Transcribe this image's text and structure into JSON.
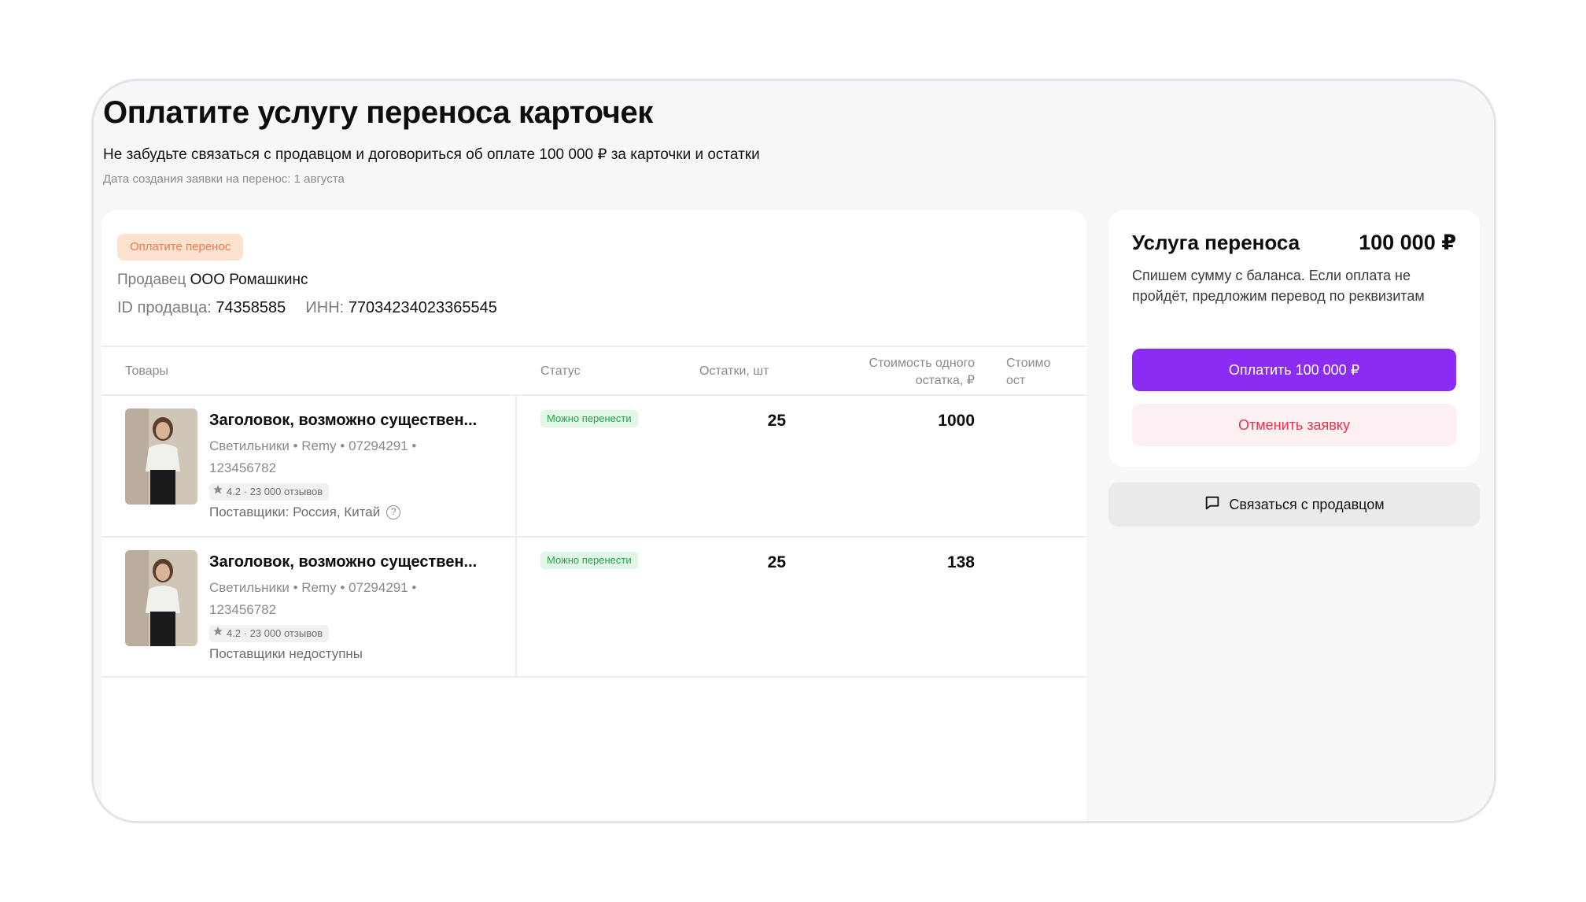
{
  "header": {
    "title": "Оплатите услугу переноса карточек",
    "subtitle": "Не забудьте связаться с продавцом и договориться об оплате 100 000 ₽ за карточки и остатки",
    "date": "Дата создания заявки на перенос: 1 августа"
  },
  "seller": {
    "status_badge": "Оплатите перенос",
    "seller_label": "Продавец",
    "seller_name": "ООО Ромашкинс",
    "id_label": "ID продавца:",
    "id_value": "74358585",
    "inn_label": "ИНН:",
    "inn_value": "77034234023365545"
  },
  "table": {
    "columns": {
      "goods": "Товары",
      "status": "Статус",
      "stock": "Остатки, шт",
      "price_line1": "Стоимость одного",
      "price_line2": "остатка, ₽",
      "total_line1": "Стоимо",
      "total_line2": "ост"
    },
    "rows": [
      {
        "title": "Заголовок, возможно существен...",
        "meta_line1": "Светильники • Remy • 07294291 •",
        "meta_line2": "123456782",
        "rating": "4.2 · 23 000 отзывов",
        "suppliers": "Поставщики: Россия, Китай",
        "status": "Можно перенести",
        "stock": "25",
        "price": "1000"
      },
      {
        "title": "Заголовок, возможно существен...",
        "meta_line1": "Светильники • Remy • 07294291 •",
        "meta_line2": "123456782",
        "rating": "4.2 · 23 000 отзывов",
        "suppliers": "Поставщики недоступны",
        "status": "Можно перенести",
        "stock": "25",
        "price": "138"
      }
    ]
  },
  "service": {
    "title": "Услуга переноса",
    "price": "100 000 ₽",
    "description": "Спишем сумму с баланса. Если оплата не пройдёт, предложим перевод по реквизитам",
    "pay_label": "Оплатить 100 000 ₽",
    "cancel_label": "Отменить заявку",
    "contact_label": "Связаться с продавцом"
  },
  "colors": {
    "accent": "#8b2cf5",
    "cancel_text": "#f0304f",
    "warning_badge_bg": "#fde3cf",
    "success_badge_text": "#22a64a"
  },
  "icons": [
    "star-icon",
    "help-icon",
    "chat-icon"
  ]
}
